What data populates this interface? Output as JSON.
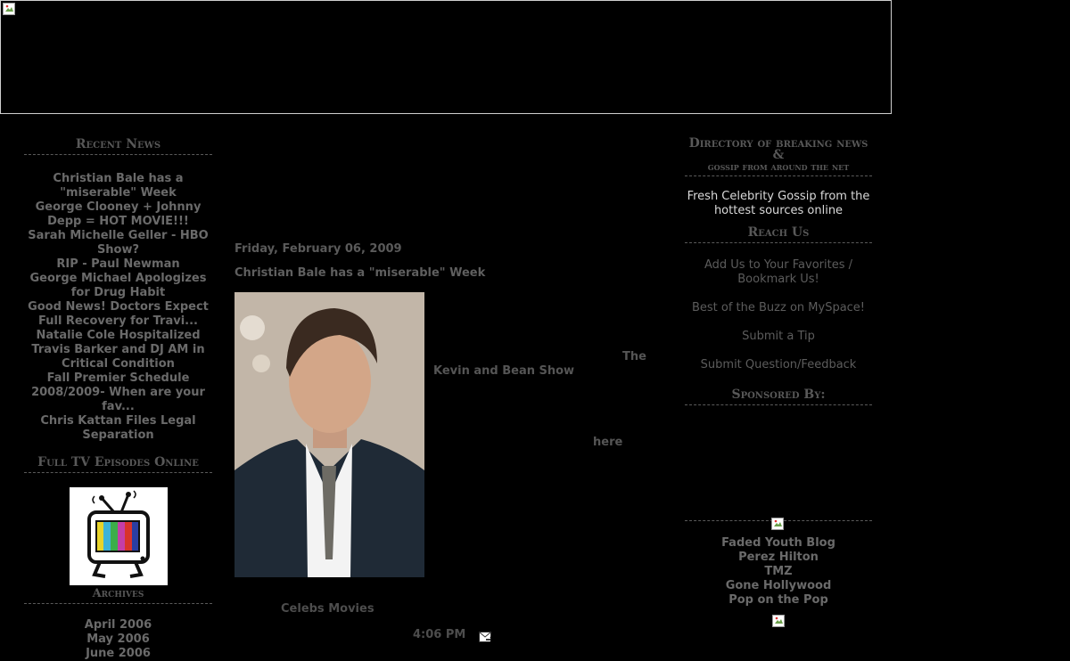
{
  "left": {
    "recent_news_heading": "Recent News",
    "news": [
      "Christian Bale has a \"miserable\" Week",
      "George Clooney + Johnny Depp = HOT MOVIE!!!",
      "Sarah Michelle Geller - HBO Show?",
      "RIP - Paul Newman",
      "George Michael Apologizes for Drug Habit",
      "Good News! Doctors Expect Full Recovery for Travi...",
      "Natalie Cole Hospitalized",
      "Travis Barker and DJ AM in Critical Condition",
      "Fall Premier Schedule 2008/2009- When are your fav...",
      "Chris Kattan Files Legal Separation"
    ],
    "tv_heading": "Full TV Episodes Online",
    "archives_heading": "Archives",
    "archives": [
      "April 2006",
      "May 2006",
      "June 2006"
    ]
  },
  "main": {
    "date": "Friday, February 06, 2009",
    "title": "Christian Bale has a \"miserable\" Week",
    "word_the": "The",
    "word_show": "Kevin  and  Bean  Show",
    "word_here": "here",
    "labels": "Celebs  Movies",
    "time": "4:06 PM"
  },
  "right": {
    "directory_heading_main": "Directory of breaking news &",
    "directory_heading_sub": "gossip from around the net",
    "gossip_text": "Fresh Celebrity Gossip from the hottest sources online",
    "reach_heading": "Reach Us",
    "reach_links": [
      "Add Us to Your Favorites / Bookmark Us!",
      "Best of the Buzz on MySpace!",
      "Submit a Tip",
      "Submit Question/Feedback"
    ],
    "sponsored_heading": "Sponsored By:",
    "partners": [
      "Faded Youth Blog",
      "Perez Hilton",
      "TMZ",
      "Gone Hollywood",
      "Pop on the Pop"
    ]
  }
}
